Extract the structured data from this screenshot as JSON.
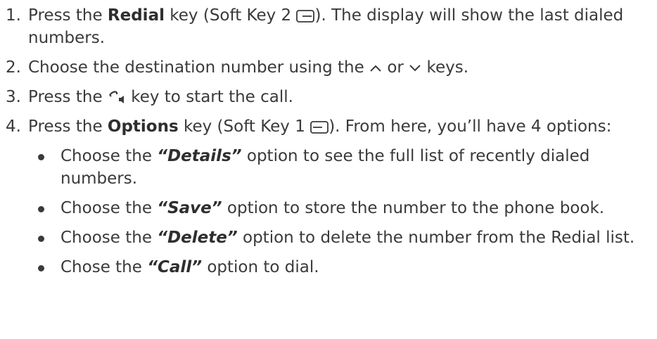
{
  "steps": [
    {
      "number": "1.",
      "before": "Press the ",
      "key": "Redial",
      "middle": " key (Soft Key 2 ",
      "icon": "soft-key-2-icon",
      "after": "). The display will show the last dialed numbers."
    },
    {
      "number": "2.",
      "before": "Choose the destination number using the ",
      "icon_up": "up-arrow-icon",
      "or": " or ",
      "icon_down": "down-arrow-icon",
      "after": " keys."
    },
    {
      "number": "3.",
      "before": "Press the ",
      "icon": "call-handset-icon",
      "after": " key to start the call."
    },
    {
      "number": "4.",
      "before": "Press the ",
      "key": "Options",
      "middle": " key (Soft Key 1 ",
      "icon": "soft-key-1-icon",
      "after": "). From here, you’ll have 4 options:",
      "options": [
        {
          "before": "Choose the ",
          "name": "“Details”",
          "after": " option to see the full list of recently dialed numbers."
        },
        {
          "before": "Choose the ",
          "name": "“Save”",
          "after": " option to store the number to the phone book."
        },
        {
          "before": "Choose the ",
          "name": "“Delete”",
          "after": " option to delete the number from the Redial list."
        },
        {
          "before": "Chose the ",
          "name": "“Call”",
          "after": " option to dial."
        }
      ]
    }
  ]
}
